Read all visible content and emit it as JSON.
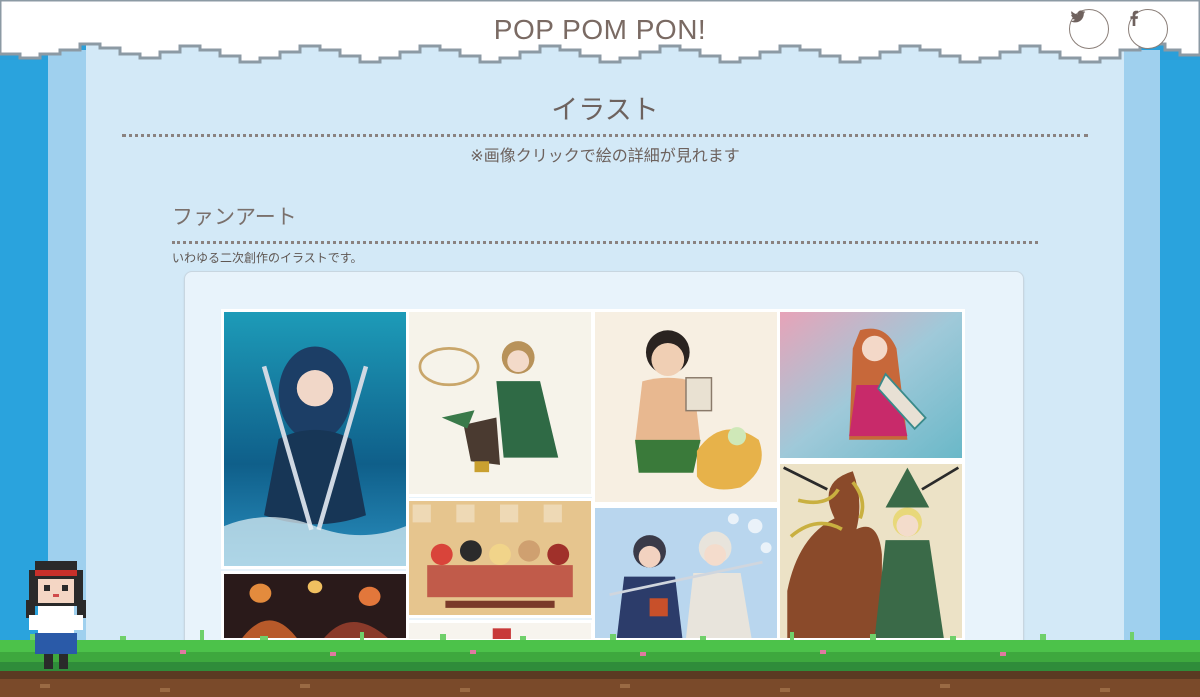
{
  "site": {
    "title": "POP POM PON!"
  },
  "social": {
    "twitter_icon": "twitter-icon",
    "facebook_icon": "facebook-icon"
  },
  "page": {
    "title": "イラスト",
    "note": "※画像クリックで絵の詳細が見れます"
  },
  "section": {
    "title": "ファンアート",
    "description": "いわゆる二次創作のイラストです。"
  },
  "gallery": {
    "items": [
      {
        "name": "ocean-swords-girl-thumb"
      },
      {
        "name": "cloaked-girl-sitting-thumb"
      },
      {
        "name": "boy-with-book-thumb"
      },
      {
        "name": "long-hair-girl-pink-dress-thumb"
      },
      {
        "name": "group-of-girls-thumb"
      },
      {
        "name": "swordsmen-duo-thumb"
      },
      {
        "name": "tree-witch-thumb"
      },
      {
        "name": "night-festival-thumb"
      },
      {
        "name": "partial-bottom-thumb"
      }
    ]
  },
  "colors": {
    "sky": "#2aa3dd",
    "panel": "#d3e9f7",
    "text": "#6d625e",
    "grass": "#4cc24a",
    "soil": "#7a4a2a"
  }
}
